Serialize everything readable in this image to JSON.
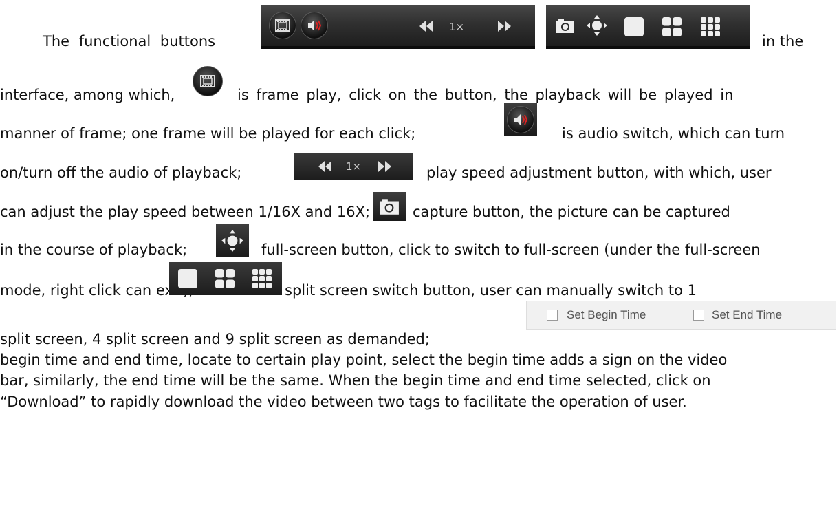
{
  "paragraph": {
    "l1a": "The functional buttons",
    "l1b": "in the",
    "l2a": "interface, among which,",
    "l2b": "is frame play, click on the button, the playback will be played in",
    "l3a": "manner of frame; one frame will be played for each click;",
    "l3b": "is audio switch, which can turn",
    "l4a": "on/turn off the audio of playback;",
    "l4b": "play speed adjustment button, with which, user",
    "l5a": "can adjust the play speed between 1/16X and 16X;",
    "l5b": "capture button, the picture can be captured",
    "l6a": "in the course of playback;",
    "l6b": "full-screen button, click to switch to full-screen (under the full-screen",
    "l7a": "mode, right click  can exit);",
    "l7b": "split screen switch button, user can manually switch to 1",
    "l8a": "split screen, 4 split screen and 9 split screen as demanded;",
    "l9": "begin time and end time, locate to certain  play point, select the begin time adds a sign on the video",
    "l10": "bar, similarly, the end time will be the same. When the begin time and end time selected, click on",
    "l11": "“Download” to rapidly download the video between two tags to facilitate the operation of user."
  },
  "toolbar": {
    "speed_label": "1×",
    "set_begin_time": "Set Begin Time",
    "set_end_time": "Set End Time"
  }
}
